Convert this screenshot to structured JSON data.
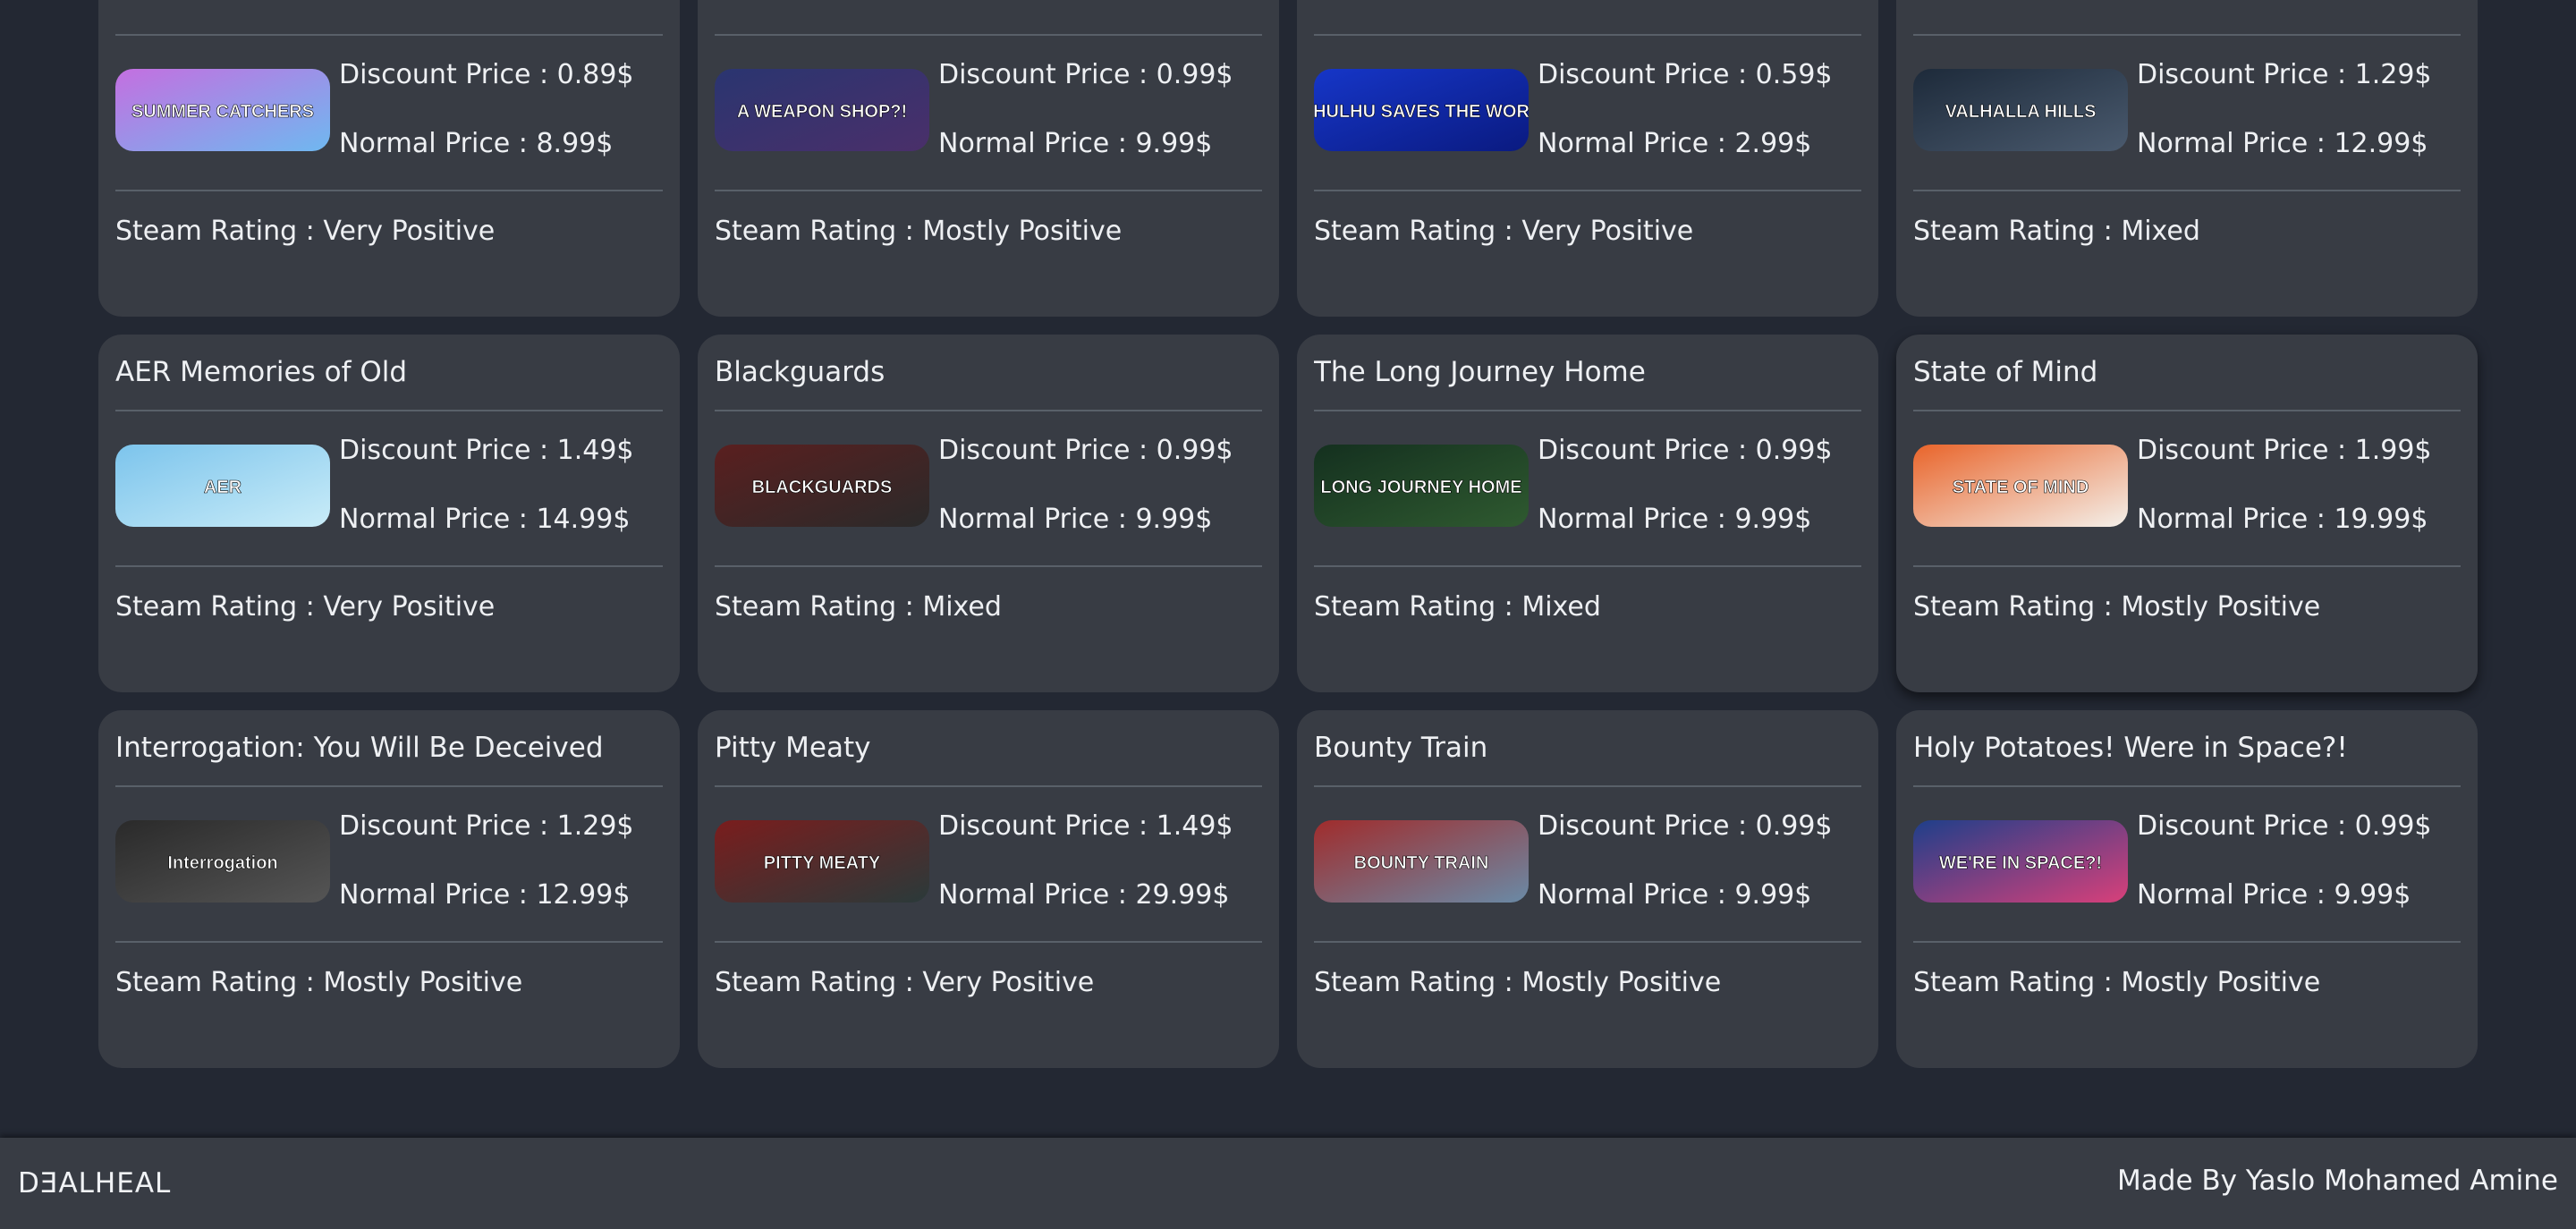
{
  "labels": {
    "discount": "Discount Price : ",
    "normal": "Normal Price : ",
    "rating": "Steam Rating : "
  },
  "games": [
    {
      "title": "",
      "discount": "0.89$",
      "normal": "8.99$",
      "rating": "Very Positive",
      "thumb_text": "SUMMER CATCHERS",
      "thumb_colors": [
        "#c46fe0",
        "#6fb8f0"
      ]
    },
    {
      "title": "",
      "discount": "0.99$",
      "normal": "9.99$",
      "rating": "Mostly Positive",
      "thumb_text": "A WEAPON SHOP?!",
      "thumb_colors": [
        "#2a3570",
        "#4a2f6a"
      ]
    },
    {
      "title": "",
      "discount": "0.59$",
      "normal": "2.99$",
      "rating": "Very Positive",
      "thumb_text": "CTHULHU SAVES THE WORLD",
      "thumb_colors": [
        "#1636c8",
        "#0a1a80"
      ]
    },
    {
      "title": "",
      "discount": "1.29$",
      "normal": "12.99$",
      "rating": "Mixed",
      "thumb_text": "VALHALLA HILLS",
      "thumb_colors": [
        "#1d2a3a",
        "#4a5a6e"
      ]
    },
    {
      "title": "AER Memories of Old",
      "discount": "1.49$",
      "normal": "14.99$",
      "rating": "Very Positive",
      "thumb_text": "AER",
      "thumb_colors": [
        "#7cc4ec",
        "#c9ecf8"
      ]
    },
    {
      "title": "Blackguards",
      "discount": "0.99$",
      "normal": "9.99$",
      "rating": "Mixed",
      "thumb_text": "BLACKGUARDS",
      "thumb_colors": [
        "#5a1f1f",
        "#2a2a2a"
      ]
    },
    {
      "title": "The Long Journey Home",
      "discount": "0.99$",
      "normal": "9.99$",
      "rating": "Mixed",
      "thumb_text": "LONG JOURNEY HOME",
      "thumb_colors": [
        "#14301f",
        "#2f5a30"
      ]
    },
    {
      "title": "State of Mind",
      "discount": "1.99$",
      "normal": "19.99$",
      "rating": "Mostly Positive",
      "thumb_text": "STATE OF MIND",
      "thumb_colors": [
        "#e9642a",
        "#f4f0ea"
      ]
    },
    {
      "title": "Interrogation: You Will Be Deceived",
      "discount": "1.29$",
      "normal": "12.99$",
      "rating": "Mostly Positive",
      "thumb_text": "Interrogation",
      "thumb_colors": [
        "#2a2a2a",
        "#555555"
      ]
    },
    {
      "title": "Pitty Meaty",
      "discount": "1.49$",
      "normal": "29.99$",
      "rating": "Very Positive",
      "thumb_text": "PITTY MEATY",
      "thumb_colors": [
        "#7a1d1d",
        "#2a3a3a"
      ]
    },
    {
      "title": "Bounty Train",
      "discount": "0.99$",
      "normal": "9.99$",
      "rating": "Mostly Positive",
      "thumb_text": "BOUNTY TRAIN",
      "thumb_colors": [
        "#a02c2c",
        "#6a8aa6"
      ]
    },
    {
      "title": "Holy Potatoes! Were in Space?!",
      "discount": "0.99$",
      "normal": "9.99$",
      "rating": "Mostly Positive",
      "thumb_text": "WE'RE IN SPACE?!",
      "thumb_colors": [
        "#1e3f8a",
        "#d8407a"
      ]
    }
  ],
  "footer": {
    "brand": "DƎALHEAL",
    "credit": "Made By Yaslo Mohamed Amine"
  },
  "colors": {
    "page_bg": "#232833",
    "card_bg": "#383c44",
    "separator": "#596069",
    "text": "#eef0f3"
  }
}
